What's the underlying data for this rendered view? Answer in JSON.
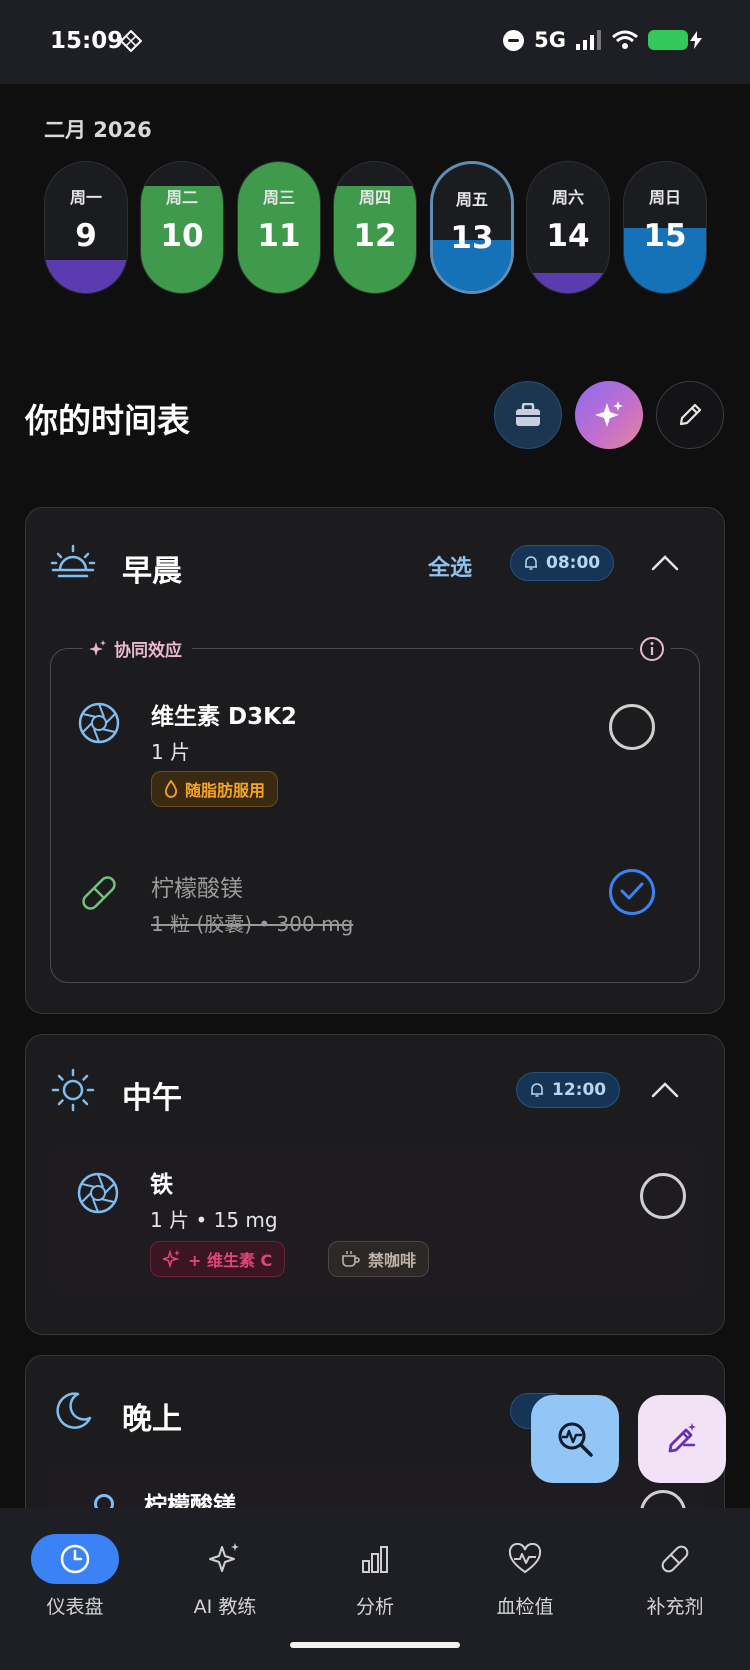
{
  "status_bar": {
    "time": "15:09",
    "network": "5G"
  },
  "calendar": {
    "month": "二月 2026",
    "days": [
      {
        "name": "周一",
        "num": "9",
        "fill_color": "#5b3bb0",
        "fill_fraction": 0.25
      },
      {
        "name": "周二",
        "num": "10",
        "fill_color": "#3f9a4c",
        "fill_fraction": 0.82
      },
      {
        "name": "周三",
        "num": "11",
        "fill_color": "#3f9a4c",
        "fill_fraction": 1.0
      },
      {
        "name": "周四",
        "num": "12",
        "fill_color": "#3f9a4c",
        "fill_fraction": 0.82
      },
      {
        "name": "周五",
        "num": "13",
        "fill_color": "#1672b8",
        "fill_fraction": 0.4,
        "today": true
      },
      {
        "name": "周六",
        "num": "14",
        "fill_color": "#5b3bb0",
        "fill_fraction": 0.15
      },
      {
        "name": "周日",
        "num": "15",
        "fill_color": "#1672b8",
        "fill_fraction": 0.5
      }
    ]
  },
  "schedule": {
    "title": "你的时间表",
    "periods": {
      "morning": {
        "label": "早晨",
        "select_all": "全选",
        "alarm": "08:00",
        "synergy_label": "协同效应",
        "items": [
          {
            "name": "维生素 D3K2",
            "dose": "1 片",
            "tag": "随脂肪服用",
            "checked": false
          },
          {
            "name": "柠檬酸镁",
            "dose": "1 粒 (胶囊) • 300 mg",
            "checked": true
          }
        ]
      },
      "noon": {
        "label": "中午",
        "alarm": "12:00",
        "items": [
          {
            "name": "铁",
            "dose": "1 片 • 15 mg",
            "tags": [
              "+ 维生素 C",
              "禁咖啡"
            ],
            "checked": false
          }
        ]
      },
      "evening": {
        "label": "晚上",
        "partial_item_name": "柠檬酸镁"
      }
    }
  },
  "bottom_nav": [
    {
      "label": "仪表盘",
      "icon": "clock-icon",
      "active": true
    },
    {
      "label": "AI 教练",
      "icon": "sparkles-icon",
      "active": false
    },
    {
      "label": "分析",
      "icon": "bar-chart-icon",
      "active": false
    },
    {
      "label": "血检值",
      "icon": "heart-pulse-icon",
      "active": false
    },
    {
      "label": "补充剂",
      "icon": "pill-icon",
      "active": false
    }
  ],
  "colors": {
    "accent_blue": "#3b82f6",
    "green": "#3f9a4c",
    "purple": "#5b3bb0",
    "blue_fill": "#1672b8"
  }
}
